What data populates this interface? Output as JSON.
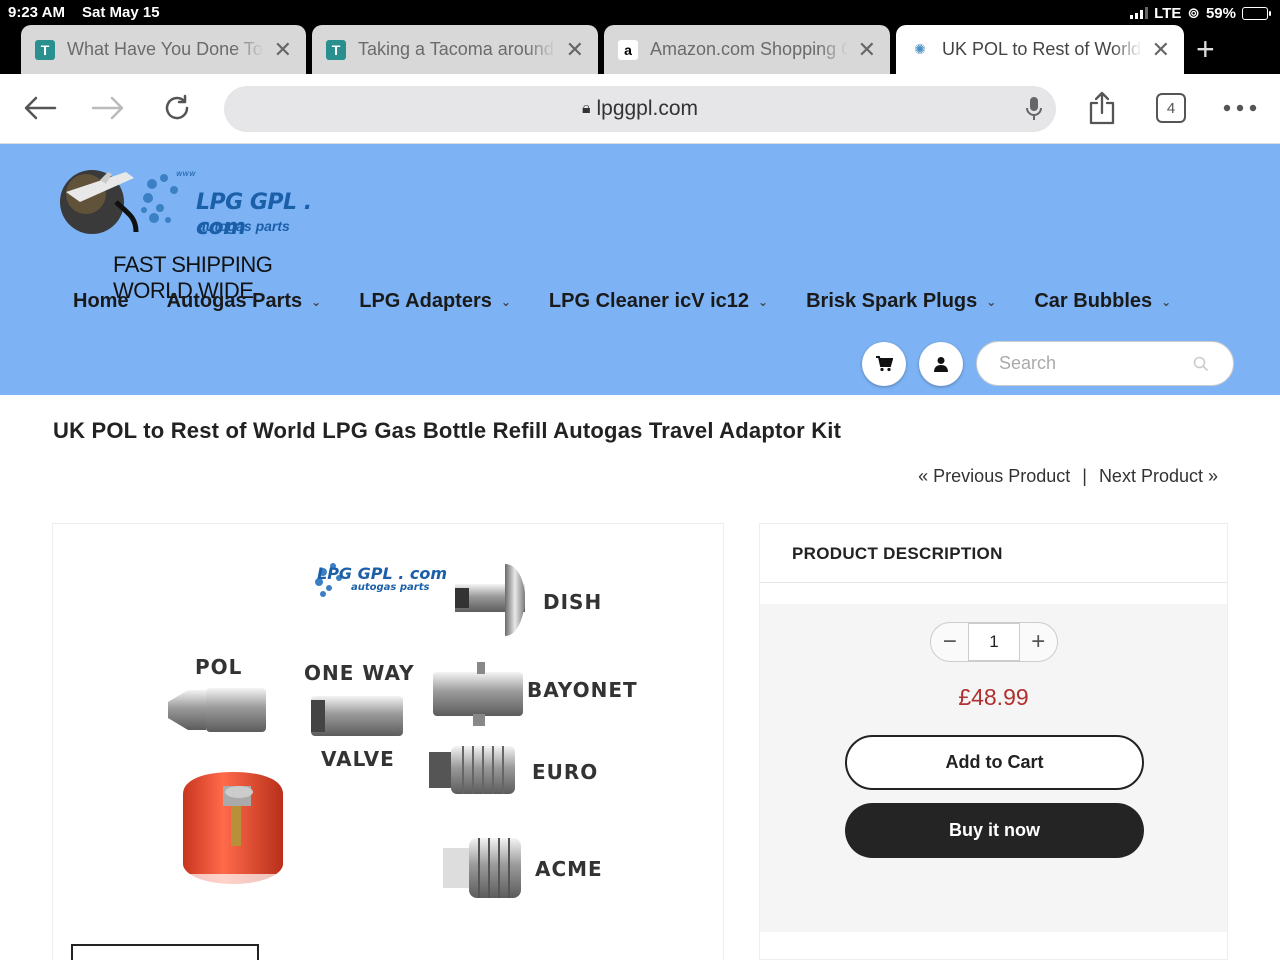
{
  "status_bar": {
    "time": "9:23 AM",
    "date": "Sat May 15",
    "network": "LTE",
    "battery": "59%",
    "battery_level": 0.59
  },
  "tabs": [
    {
      "title": "What Have You Done To Your",
      "favicon": "tw-favicon",
      "active": false
    },
    {
      "title": "Taking a Tacoma around the",
      "favicon": "tw-favicon",
      "active": false
    },
    {
      "title": "Amazon.com Shopping Cart",
      "favicon": "amazon-favicon",
      "active": false
    },
    {
      "title": "UK POL to Rest of World",
      "favicon": "lpg-favicon",
      "active": true
    }
  ],
  "toolbar": {
    "url": "lpggpl.com",
    "tab_count": "4"
  },
  "site": {
    "logo_text": "LPG GPL . com",
    "logo_www": "www",
    "logo_sub": "autogas parts",
    "tagline": "FAST SHIPPING WORLD WIDE",
    "nav": [
      {
        "label": "Home",
        "dropdown": false
      },
      {
        "label": "Autogas Parts",
        "dropdown": true
      },
      {
        "label": "LPG Adapters",
        "dropdown": true
      },
      {
        "label": "LPG Cleaner icV ic12",
        "dropdown": true
      },
      {
        "label": "Brisk Spark Plugs",
        "dropdown": true
      },
      {
        "label": "Car Bubbles",
        "dropdown": true
      }
    ],
    "search_placeholder": "Search"
  },
  "product": {
    "title": "UK POL to Rest of World LPG Gas Bottle Refill Autogas Travel Adaptor Kit",
    "prev_label": "Previous Product",
    "next_label": "Next Product",
    "separator": "|",
    "image_labels": {
      "pol": "POL",
      "one_way": "ONE WAY",
      "valve": "VALVE",
      "dish": "DISH",
      "bayonet": "BAYONET",
      "euro": "EURO",
      "acme": "ACME",
      "logo": "LPG GPL . com",
      "logo_sub": "autogas parts"
    },
    "description_heading": "PRODUCT DESCRIPTION",
    "quantity": "1",
    "price": "£48.99",
    "add_to_cart": "Add to Cart",
    "buy_now": "Buy it now"
  }
}
